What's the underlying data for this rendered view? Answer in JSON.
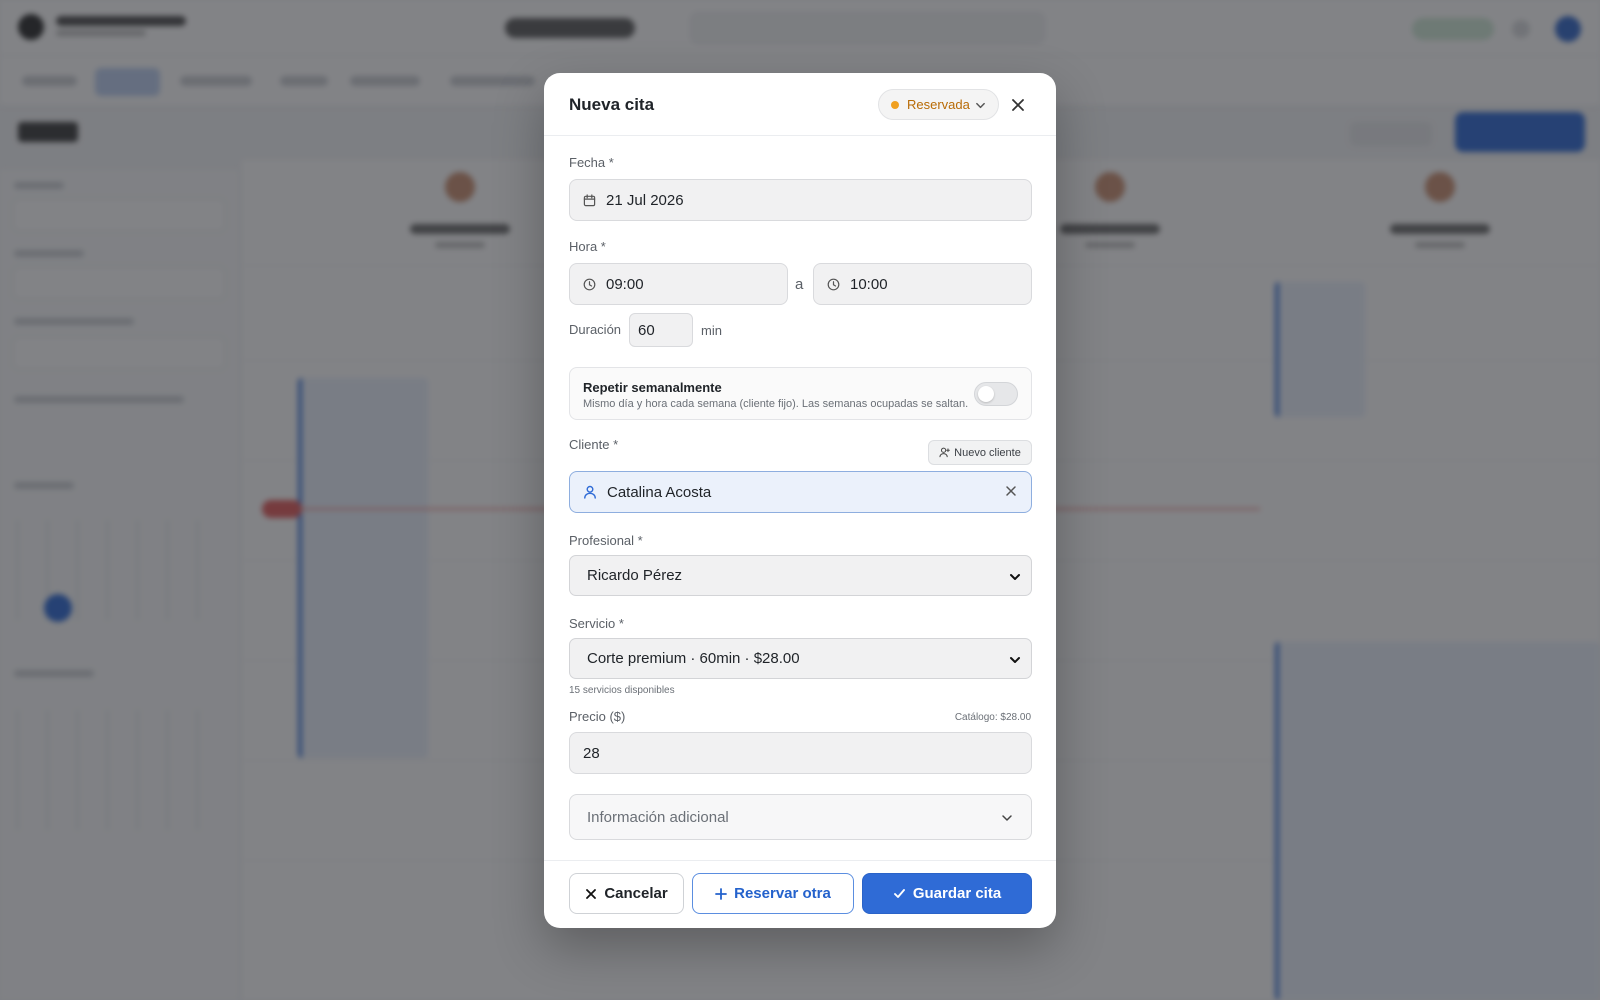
{
  "modal": {
    "title": "Nueva cita",
    "status": {
      "label": "Reservada",
      "color": "#f0a020"
    },
    "date": {
      "label": "Fecha *",
      "value": "21 Jul 2026"
    },
    "time": {
      "label": "Hora *",
      "start": "09:00",
      "separator": "a",
      "end": "10:00"
    },
    "duration": {
      "label": "Duración",
      "value": "60",
      "unit": "min"
    },
    "repeat": {
      "title": "Repetir semanalmente",
      "subtitle": "Mismo día y hora cada semana (cliente fijo). Las semanas ocupadas se saltan.",
      "enabled": false
    },
    "client": {
      "label": "Cliente *",
      "new_button": "Nuevo cliente",
      "value": "Catalina Acosta"
    },
    "professional": {
      "label": "Profesional *",
      "value": "Ricardo Pérez"
    },
    "service": {
      "label": "Servicio *",
      "value": "Corte premium · 60min · $28.00",
      "hint": "15 servicios disponibles"
    },
    "price": {
      "label": "Precio ($)",
      "catalog": "Catálogo: $28.00",
      "value": "28"
    },
    "more_info": {
      "label": "Información adicional"
    },
    "footer": {
      "cancel": "Cancelar",
      "book_another": "Reservar otra",
      "save": "Guardar cita"
    }
  },
  "colors": {
    "primary": "#2f6bd6",
    "status_reserved": "#f0a020",
    "client_highlight": "#ebf1fb"
  },
  "icons": [
    "calendar-icon",
    "clock-icon",
    "user-icon",
    "user-plus-icon",
    "close-icon",
    "chevron-down-icon",
    "plus-icon",
    "check-icon"
  ]
}
